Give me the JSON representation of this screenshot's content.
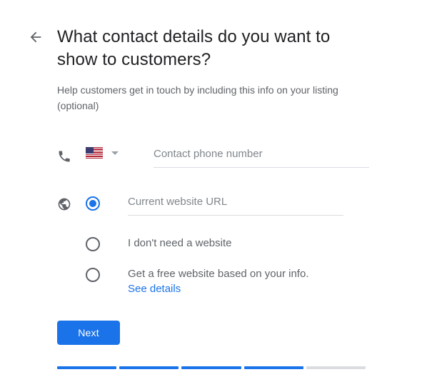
{
  "colors": {
    "accent": "#1a73e8",
    "text_primary": "#202124",
    "text_secondary": "#5f6368",
    "placeholder": "#80868b",
    "underline": "#dadce0",
    "progress_inactive": "#dadce0"
  },
  "header": {
    "back_icon": "arrow-back-icon",
    "title": "What contact details do you want to show to customers?",
    "subtitle": "Help customers get in touch by including this info on your listing (optional)"
  },
  "form": {
    "phone": {
      "icon": "phone-icon",
      "country_flag": "us-flag-icon",
      "country_caret": "chevron-down-icon",
      "placeholder": "Contact phone number",
      "value": ""
    },
    "website": {
      "icon": "globe-icon",
      "options": [
        {
          "id": "current-website",
          "type": "input",
          "selected": true,
          "placeholder": "Current website URL",
          "value": ""
        },
        {
          "id": "no-website",
          "type": "text",
          "selected": false,
          "label": "I don't need a website"
        },
        {
          "id": "free-website",
          "type": "text-with-link",
          "selected": false,
          "label": "Get a free website based on your info.",
          "link_label": "See details"
        }
      ]
    }
  },
  "actions": {
    "next_label": "Next"
  },
  "progress": {
    "total_steps": 5,
    "completed_steps": 4,
    "segments": [
      "done",
      "done",
      "done",
      "done",
      "todo"
    ]
  }
}
